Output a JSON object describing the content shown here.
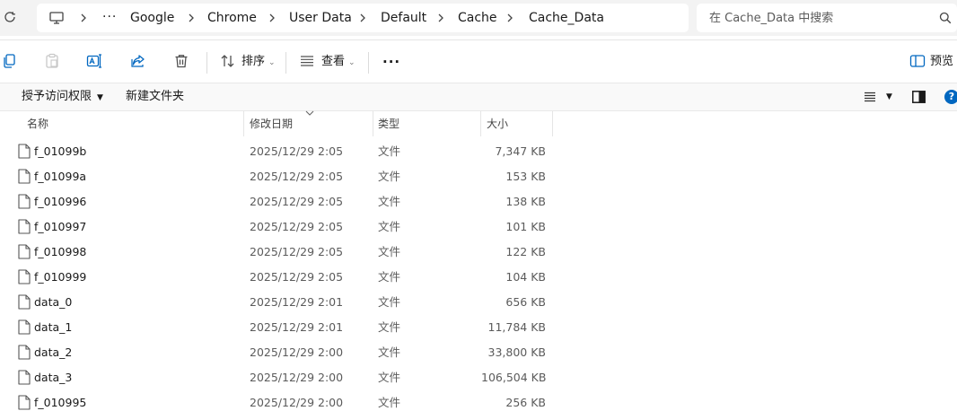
{
  "address_bar": {
    "refresh_icon": "refresh-icon",
    "root_icon": "this-pc-icon",
    "overflow_label": "···",
    "crumbs": [
      "Google",
      "Chrome",
      "User Data",
      "Default",
      "Cache",
      "Cache_Data"
    ],
    "search_placeholder": "在 Cache_Data 中搜索"
  },
  "command_bar": {
    "icons": [
      "copy-icon",
      "paste-icon",
      "rename-icon",
      "share-icon",
      "delete-icon"
    ],
    "sort_label": "排序",
    "view_label": "查看",
    "more_label": "···",
    "preview_label": "预览"
  },
  "sub_bar": {
    "grant_access_label": "授予访问权限",
    "new_folder_label": "新建文件夹",
    "help_label": "?"
  },
  "file_list": {
    "columns": [
      "名称",
      "修改日期",
      "类型",
      "大小"
    ],
    "rows": [
      {
        "name": "f_01099b",
        "date": "2025/12/29 2:05",
        "type": "文件",
        "size": "7,347 KB"
      },
      {
        "name": "f_01099a",
        "date": "2025/12/29 2:05",
        "type": "文件",
        "size": "153 KB"
      },
      {
        "name": "f_010996",
        "date": "2025/12/29 2:05",
        "type": "文件",
        "size": "138 KB"
      },
      {
        "name": "f_010997",
        "date": "2025/12/29 2:05",
        "type": "文件",
        "size": "101 KB"
      },
      {
        "name": "f_010998",
        "date": "2025/12/29 2:05",
        "type": "文件",
        "size": "122 KB"
      },
      {
        "name": "f_010999",
        "date": "2025/12/29 2:05",
        "type": "文件",
        "size": "104 KB"
      },
      {
        "name": "data_0",
        "date": "2025/12/29 2:01",
        "type": "文件",
        "size": "656 KB"
      },
      {
        "name": "data_1",
        "date": "2025/12/29 2:01",
        "type": "文件",
        "size": "11,784 KB"
      },
      {
        "name": "data_2",
        "date": "2025/12/29 2:00",
        "type": "文件",
        "size": "33,800 KB"
      },
      {
        "name": "data_3",
        "date": "2025/12/29 2:00",
        "type": "文件",
        "size": "106,504 KB"
      },
      {
        "name": "f_010995",
        "date": "2025/12/29 2:00",
        "type": "文件",
        "size": "256 KB"
      }
    ]
  },
  "colors": {
    "accent": "#0067c0",
    "icon_grey": "#505050",
    "address_bg": "#f3f3f3"
  }
}
